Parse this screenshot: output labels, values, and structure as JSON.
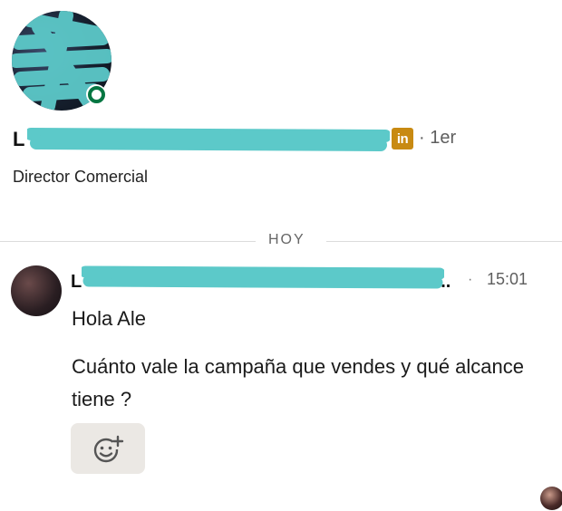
{
  "profile": {
    "name_prefix": "L",
    "connection_degree": "1er",
    "degree_separator": "·",
    "linkedin_badge": "in",
    "headline": "Director Comercial",
    "online_status_color": "#057642",
    "redaction_color": "#5cc9c9"
  },
  "divider": {
    "label": "HOY"
  },
  "message": {
    "sender_prefix": "L",
    "sender_suffix": "..",
    "timestamp_separator": "·",
    "timestamp": "15:01",
    "lines": [
      "Hola Ale",
      "Cuánto vale la campaña que vendes y qué alcance tiene ?"
    ],
    "reaction_icon": "add-reaction-smiley-icon"
  }
}
